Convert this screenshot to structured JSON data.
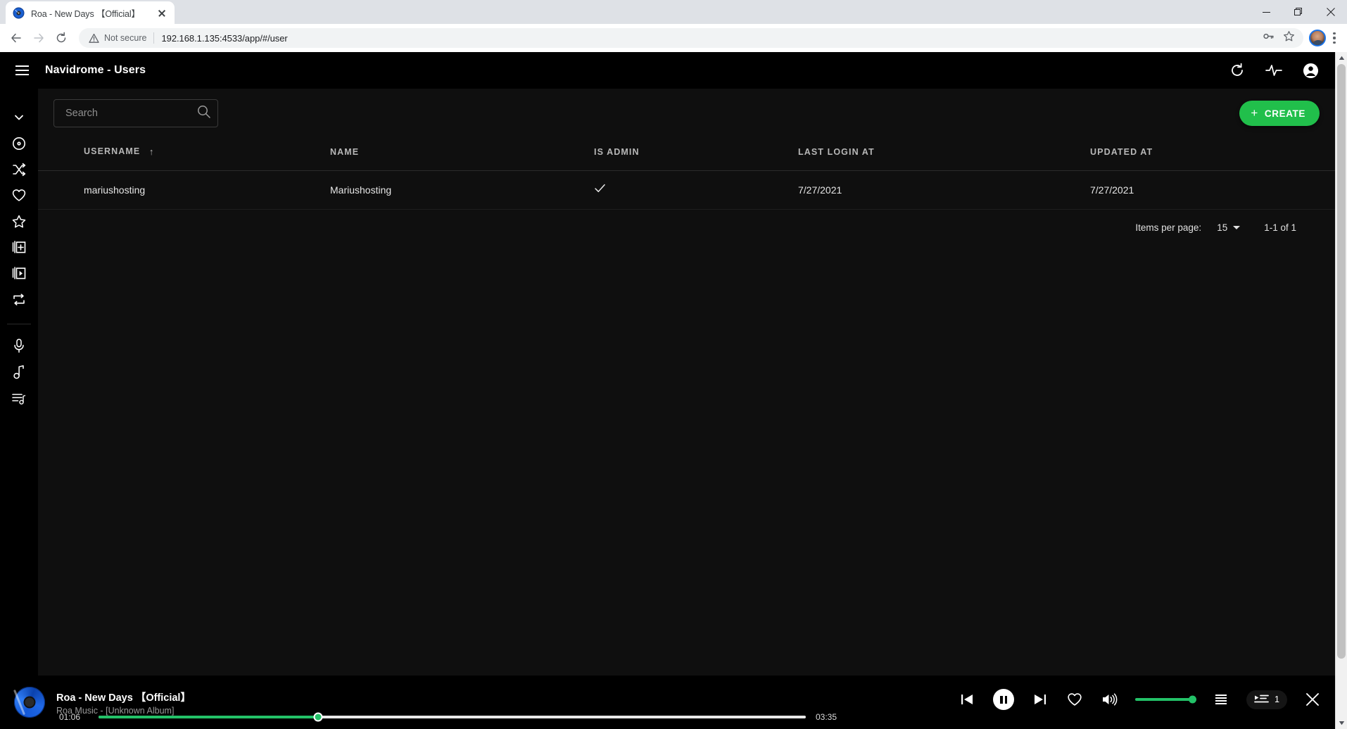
{
  "browser": {
    "tab": {
      "title": "Roa - New Days 【Official】",
      "favicon": "vinyl-disc-icon",
      "close": "close-icon"
    },
    "window_controls": {
      "minimize": "minimize-icon",
      "maximize": "maximize-icon",
      "close": "close-icon"
    },
    "nav": {
      "back": "back-arrow-icon",
      "forward": "forward-arrow-icon",
      "reload": "reload-icon"
    },
    "omnibox": {
      "security_icon": "warning-triangle-icon",
      "security_label": "Not secure",
      "url": "192.168.1.135:4533/app/#/user",
      "url_host": "192.168.1.135:4533",
      "url_path": "/app/#/user",
      "password_icon": "key-icon",
      "bookmark_icon": "star-outline-icon"
    },
    "profile": {
      "name": "profile-avatar"
    },
    "menu_icon": "kebab-menu-icon"
  },
  "app": {
    "title": "Navidrome - Users",
    "menu_icon": "hamburger-menu-icon",
    "header_actions": [
      {
        "icon": "refresh-icon",
        "name": "refresh-button"
      },
      {
        "icon": "activity-pulse-icon",
        "name": "activity-button"
      },
      {
        "icon": "account-circle-icon",
        "name": "account-button"
      }
    ]
  },
  "sidebar": {
    "items": [
      {
        "icon": "chevron-down-icon",
        "name": "sidebar-item-collapse"
      },
      {
        "icon": "album-disc-icon",
        "name": "sidebar-item-albums"
      },
      {
        "icon": "shuffle-icon",
        "name": "sidebar-item-shuffle"
      },
      {
        "icon": "heart-icon",
        "name": "sidebar-item-favourites"
      },
      {
        "icon": "star-icon",
        "name": "sidebar-item-top-rated"
      },
      {
        "icon": "add-to-library-icon",
        "name": "sidebar-item-recently-added"
      },
      {
        "icon": "recently-played-icon",
        "name": "sidebar-item-recently-played"
      },
      {
        "icon": "repeat-icon",
        "name": "sidebar-item-most-played"
      }
    ],
    "items_lower": [
      {
        "icon": "microphone-icon",
        "name": "sidebar-item-artists"
      },
      {
        "icon": "music-note-icon",
        "name": "sidebar-item-songs"
      },
      {
        "icon": "playlist-icon",
        "name": "sidebar-item-playlists"
      }
    ]
  },
  "search": {
    "placeholder": "Search",
    "value": "",
    "icon": "search-icon"
  },
  "create_button": {
    "label": "CREATE",
    "icon": "plus-icon",
    "color": "#21bf4b"
  },
  "table": {
    "columns": [
      {
        "label": "USERNAME",
        "sorted": true,
        "sort_direction": "asc",
        "sort_icon": "arrow-up-icon"
      },
      {
        "label": "NAME",
        "sorted": false
      },
      {
        "label": "IS ADMIN",
        "sorted": false
      },
      {
        "label": "LAST LOGIN AT",
        "sorted": false
      },
      {
        "label": "UPDATED AT",
        "sorted": false
      }
    ],
    "rows": [
      {
        "username": "mariushosting",
        "name": "Mariushosting",
        "is_admin": true,
        "is_admin_icon": "check-icon",
        "last_login_at": "7/27/2021",
        "updated_at": "7/27/2021"
      }
    ]
  },
  "pagination": {
    "items_per_page_label": "Items per page:",
    "items_per_page_value": "15",
    "dropdown_icon": "caret-down-icon",
    "range": "1-1 of 1"
  },
  "player": {
    "cover_icon": "vinyl-disc-cover",
    "track_title": "Roa - New Days 【Official】",
    "track_subtitle": "Roa Music - [Unknown Album]",
    "current_time": "01:06",
    "total_time": "03:35",
    "progress_percent": 31,
    "controls": [
      {
        "icon": "previous-track-icon",
        "name": "previous-button"
      },
      {
        "icon": "pause-icon",
        "name": "pause-button"
      },
      {
        "icon": "next-track-icon",
        "name": "next-button"
      },
      {
        "icon": "heart-outline-icon",
        "name": "favourite-button"
      },
      {
        "icon": "volume-up-icon",
        "name": "volume-button"
      }
    ],
    "volume_percent": 100,
    "lyrics_icon": "lyrics-list-icon",
    "queue_icon": "queue-list-icon",
    "queue_count": "1",
    "close_icon": "close-icon"
  },
  "colors": {
    "accent_green": "#21bf4b",
    "progress_green": "#23c268",
    "app_background": "#000000",
    "content_background": "#0f0f0f"
  }
}
